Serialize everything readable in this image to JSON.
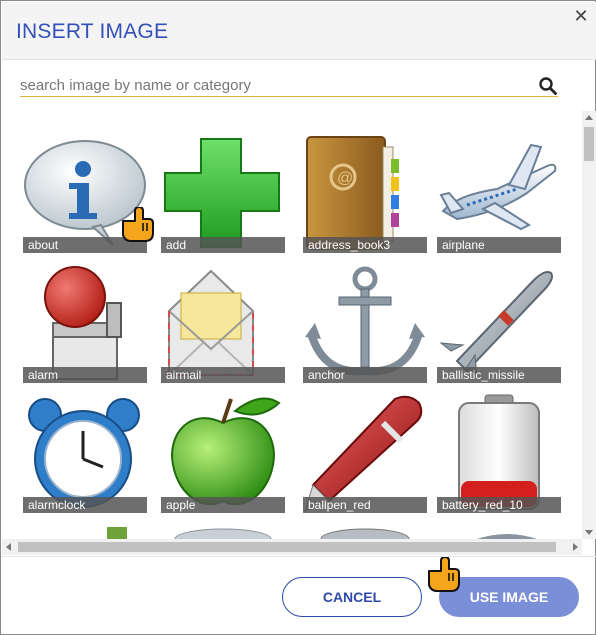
{
  "dialog": {
    "title": "INSERT IMAGE",
    "close_glyph": "✕"
  },
  "search": {
    "placeholder": "search image by name or category",
    "value": ""
  },
  "gallery": {
    "items": [
      {
        "label": "about",
        "icon": "info-bubble-icon"
      },
      {
        "label": "add",
        "icon": "plus-icon"
      },
      {
        "label": "address_book3",
        "icon": "address-book-icon"
      },
      {
        "label": "airplane",
        "icon": "airplane-icon"
      },
      {
        "label": "alarm",
        "icon": "alarm-bell-icon"
      },
      {
        "label": "airmail",
        "icon": "airmail-envelope-icon"
      },
      {
        "label": "anchor",
        "icon": "anchor-icon"
      },
      {
        "label": "ballistic_missile",
        "icon": "missile-icon"
      },
      {
        "label": "alarmclock",
        "icon": "alarm-clock-icon"
      },
      {
        "label": "apple",
        "icon": "apple-icon"
      },
      {
        "label": "ballpen_red",
        "icon": "red-pen-icon"
      },
      {
        "label": "battery_red_10",
        "icon": "battery-icon"
      }
    ]
  },
  "footer": {
    "cancel_label": "CANCEL",
    "use_label": "USE IMAGE"
  },
  "colors": {
    "title": "#3450b8",
    "accent_underline": "#e0b23a",
    "primary_button": "#7b8fd8",
    "secondary_button_border": "#2d4aa8"
  }
}
